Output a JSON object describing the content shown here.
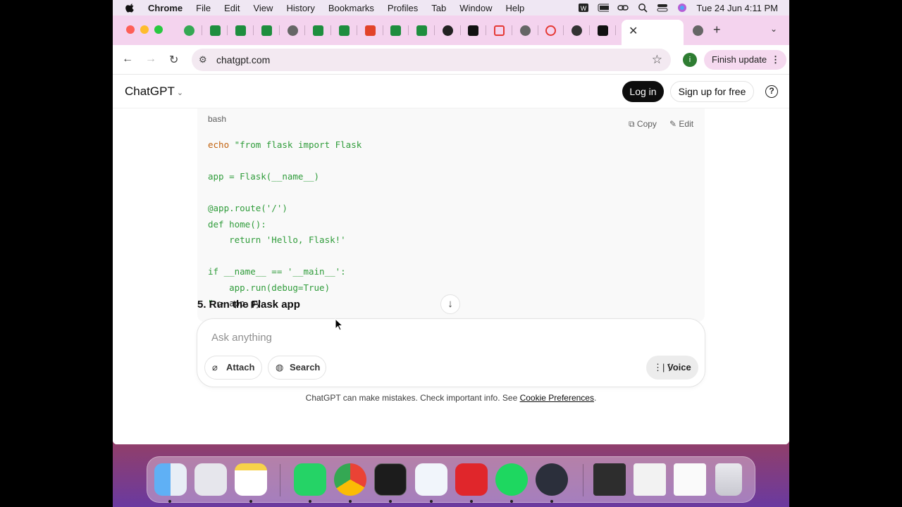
{
  "menubar": {
    "app": "Chrome",
    "items": [
      "File",
      "Edit",
      "View",
      "History",
      "Bookmarks",
      "Profiles",
      "Tab",
      "Window",
      "Help"
    ],
    "datetime": "Tue 24 Jun  4:11 PM"
  },
  "browser": {
    "url": "chatgpt.com",
    "finish_update": "Finish update",
    "profile_initial": "i",
    "tab_icons": [
      "green-icon",
      "sheets-icon",
      "sheets-icon",
      "sheets-icon",
      "globe-icon",
      "sheets-icon",
      "sheets-icon",
      "gitlab-icon",
      "sheets-icon",
      "sheets-icon",
      "github-icon",
      "app-icon",
      "record-icon",
      "globe-icon",
      "wifi-icon",
      "openai-icon",
      "app-icon",
      "app-icon",
      "ai-icon"
    ]
  },
  "header": {
    "brand": "ChatGPT",
    "login": "Log in",
    "signup": "Sign up for free",
    "help": "?"
  },
  "codeblock": {
    "language": "bash",
    "copy": "Copy",
    "edit": "Edit",
    "lines": [
      [
        {
          "t": "echo",
          "c": "kw"
        },
        {
          "t": " \"from flask import Flask",
          "c": "str"
        }
      ],
      [],
      [
        {
          "t": "app = Flask(__name__)",
          "c": "str"
        }
      ],
      [],
      [
        {
          "t": "@app.route('/')",
          "c": "str"
        }
      ],
      [
        {
          "t": "def home():",
          "c": "str"
        }
      ],
      [
        {
          "t": "    return 'Hello, Flask!'",
          "c": "str"
        }
      ],
      [],
      [
        {
          "t": "if __name__ == '__main__':",
          "c": "str"
        }
      ],
      [
        {
          "t": "    app.run(debug=True)",
          "c": "str"
        }
      ],
      [
        {
          "t": "\"",
          "c": "str"
        },
        {
          "t": " > app.py",
          "c": "plain"
        }
      ]
    ]
  },
  "step": "5. Run the Flask app",
  "composer": {
    "placeholder": "Ask anything",
    "attach": "Attach",
    "search": "Search",
    "voice": "Voice"
  },
  "disclaimer": {
    "text": "ChatGPT can make mistakes. Check important info. See ",
    "link": "Cookie Preferences",
    "end": "."
  },
  "dock": [
    "Finder",
    "Launchpad",
    "Notes",
    "WhatsApp",
    "Chrome",
    "Terminal",
    "VS Code",
    "WPS Office",
    "Spotify",
    "OBS",
    "Window preview",
    "Window preview",
    "Window preview",
    "Trash"
  ]
}
